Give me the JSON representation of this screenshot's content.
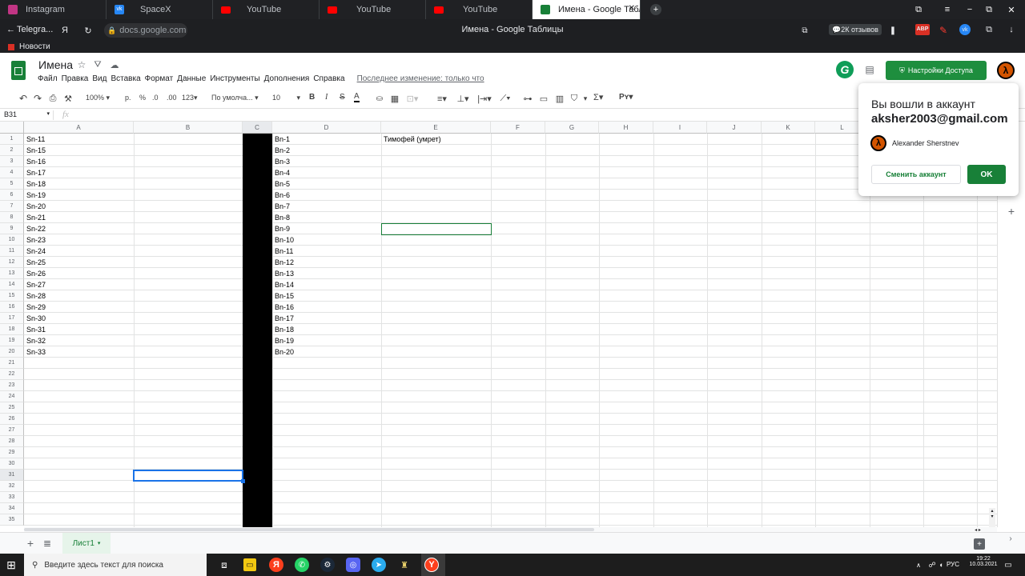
{
  "browser": {
    "tabs": [
      {
        "label": "Instagram",
        "icon": "instagram-icon"
      },
      {
        "label": "SpaceX",
        "icon": "vk-icon"
      },
      {
        "label": "YouTube",
        "icon": "youtube-icon"
      },
      {
        "label": "YouTube",
        "icon": "youtube-icon"
      },
      {
        "label": "YouTube",
        "icon": "youtube-icon"
      },
      {
        "label": "Имена - Google Таблиц",
        "icon": "sheets-icon"
      }
    ],
    "back_label": "Telegra...",
    "address": "docs.google.com",
    "page_title": "Имена - Google Таблицы",
    "reviews_badge": "2К отзывов",
    "abp_badge": "ABP",
    "bookmark_news": "Новости"
  },
  "doc": {
    "title": "Имена",
    "menu": [
      "Файл",
      "Правка",
      "Вид",
      "Вставка",
      "Формат",
      "Данные",
      "Инструменты",
      "Дополнения",
      "Справка"
    ],
    "last_edit": "Последнее изменение: только что",
    "share_label": "Настройки Доступа"
  },
  "toolbar": {
    "zoom": "100%",
    "currency": "р.",
    "percent": "%",
    "dec_less": ".0",
    "dec_more": ".00",
    "format_more": "123",
    "font": "По умолча...",
    "font_size": "10",
    "bold": "B",
    "italic": "I",
    "strike": "S",
    "text_color": "A",
    "sigma": "Σ",
    "input_tools": "Рʏ"
  },
  "formula": {
    "cell_ref": "B31",
    "fx": "fx",
    "content": ""
  },
  "grid": {
    "columns": [
      "A",
      "B",
      "C",
      "D",
      "E",
      "F",
      "G",
      "H",
      "I",
      "J",
      "K",
      "L"
    ],
    "rows": [
      "1",
      "2",
      "3",
      "4",
      "5",
      "6",
      "7",
      "8",
      "9",
      "10",
      "11",
      "12",
      "13",
      "14",
      "15",
      "16",
      "17",
      "18",
      "19",
      "20",
      "21",
      "22",
      "23",
      "24",
      "25",
      "26",
      "27",
      "28",
      "29",
      "30",
      "31",
      "32",
      "33",
      "34",
      "35"
    ],
    "col_a": [
      "Sn-11",
      "Sn-15",
      "Sn-16",
      "Sn-17",
      "Sn-18",
      "Sn-19",
      "Sn-20",
      "Sn-21",
      "Sn-22",
      "Sn-23",
      "Sn-24",
      "Sn-25",
      "Sn-26",
      "Sn-27",
      "Sn-28",
      "Sn-29",
      "Sn-30",
      "Sn-31",
      "Sn-32",
      "Sn-33"
    ],
    "col_d": [
      "Bn-1",
      "Bn-2",
      "Bn-3",
      "Bn-4",
      "Bn-5",
      "Bn-6",
      "Bn-7",
      "Bn-8",
      "Bn-9",
      "Bn-10",
      "Bn-11",
      "Bn-12",
      "Bn-13",
      "Bn-14",
      "Bn-15",
      "Bn-16",
      "Bn-17",
      "Bn-18",
      "Bn-19",
      "Bn-20"
    ],
    "b1": "",
    "b4": "",
    "e1": "Тимофей (умрет)",
    "fill_color_c": "#000000"
  },
  "account_popup": {
    "title": "Вы вошли в аккаунт",
    "email": "aksher2003@gmail.com",
    "name": "Alexander Sherstnev",
    "switch_label": "Сменить аккаунт",
    "ok_label": "OK"
  },
  "sheets": {
    "tab_label": "Лист1"
  },
  "taskbar": {
    "search_placeholder": "Введите здесь текст для поиска",
    "lang": "РУС",
    "time": "19:22",
    "date": "10.03.2021"
  },
  "colors": {
    "sheets_green": "#188038",
    "share_green": "#1e8e3e",
    "selection_blue": "#1a73e8"
  }
}
